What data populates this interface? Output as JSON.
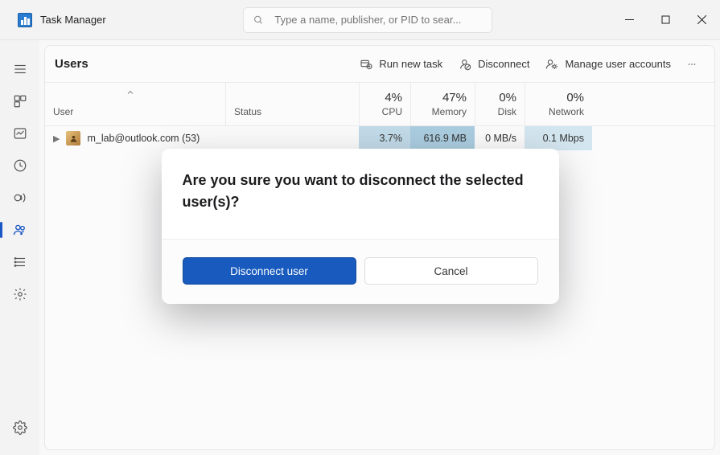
{
  "app": {
    "title": "Task Manager"
  },
  "search": {
    "placeholder": "Type a name, publisher, or PID to sear..."
  },
  "page": {
    "title": "Users"
  },
  "toolbar": {
    "run_new_task": "Run new task",
    "disconnect": "Disconnect",
    "manage_accounts": "Manage user accounts"
  },
  "columns": {
    "user": "User",
    "status": "Status",
    "cpu": {
      "pct": "4%",
      "label": "CPU"
    },
    "memory": {
      "pct": "47%",
      "label": "Memory"
    },
    "disk": {
      "pct": "0%",
      "label": "Disk"
    },
    "network": {
      "pct": "0%",
      "label": "Network"
    }
  },
  "rows": [
    {
      "user": "m_lab@outlook.com (53)",
      "status": "",
      "cpu": "3.7%",
      "memory": "616.9 MB",
      "disk": "0 MB/s",
      "network": "0.1 Mbps"
    }
  ],
  "dialog": {
    "message": "Are you sure you want to disconnect the selected user(s)?",
    "primary": "Disconnect user",
    "secondary": "Cancel"
  },
  "nav": {
    "items": [
      "processes",
      "performance",
      "app-history",
      "startup-apps",
      "users",
      "details",
      "services"
    ],
    "selected": "users"
  }
}
